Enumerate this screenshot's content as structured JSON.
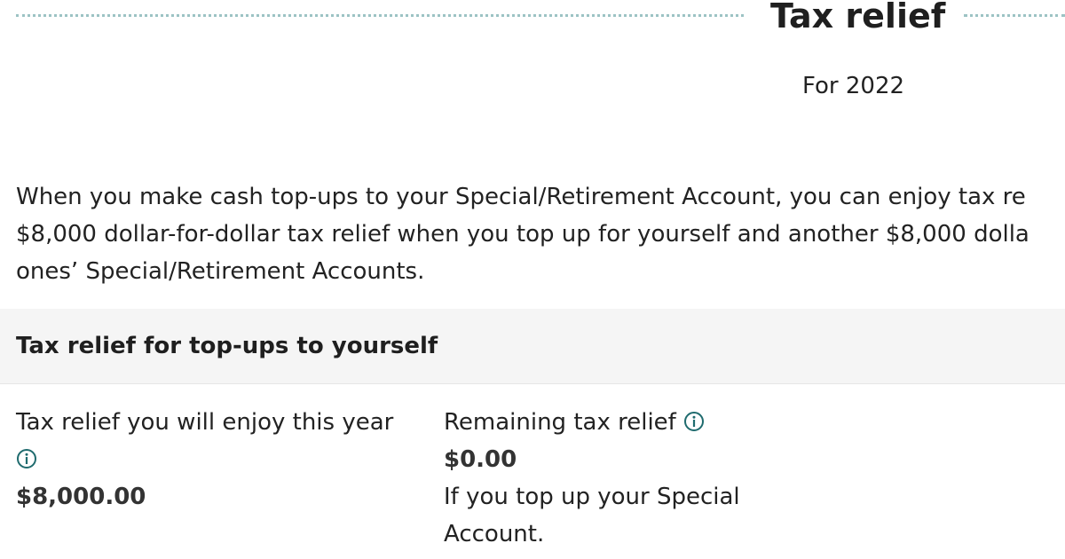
{
  "header": {
    "title": "Tax relief",
    "subtitle": "For 2022",
    "dots_color": "#9cc3c4"
  },
  "intro": {
    "lines": [
      "When you make cash top-ups to your Special/Retirement Account, you can enjoy tax re",
      "$8,000 dollar-for-dollar tax relief when you top up for yourself and another $8,000 dolla",
      "ones’ Special/Retirement Accounts."
    ]
  },
  "section": {
    "title": "Tax relief for top-ups to yourself"
  },
  "left_panel": {
    "label": "Tax relief you will enjoy this year",
    "icon": "info-icon",
    "value": "$8,000.00"
  },
  "right_panel": {
    "label": "Remaining tax relief",
    "icon": "info-icon",
    "value": "$0.00",
    "note_lines": [
      "If you top up your Special",
      "Account."
    ]
  },
  "colors": {
    "icon": "#1f6b6e",
    "band": "#f5f5f5"
  }
}
